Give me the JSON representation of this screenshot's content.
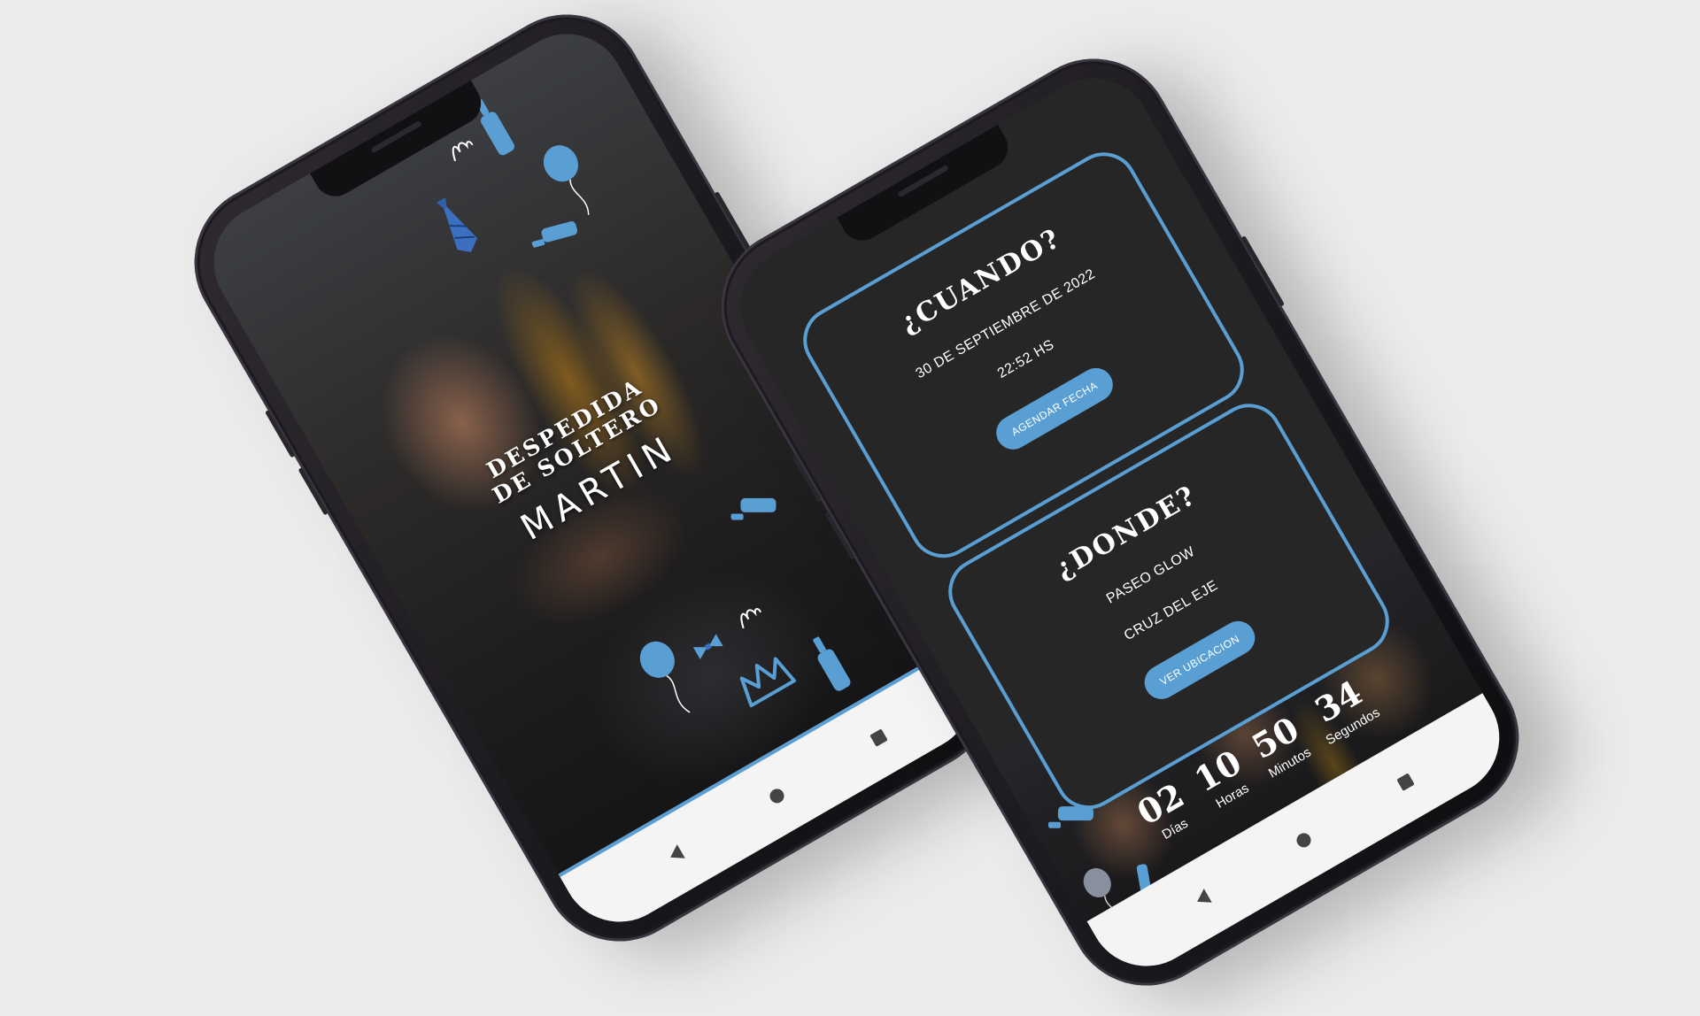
{
  "invitation": {
    "title": "DESPEDIDA DE SOLTERO",
    "name": "MARTIN"
  },
  "when": {
    "title": "¿CUANDO?",
    "date": "30 DE SEPTIEMBRE DE 2022",
    "time": "22:52 HS",
    "button": "AGENDAR FECHA"
  },
  "where": {
    "title": "¿DONDE?",
    "place": "PASEO GLOW",
    "city": "CRUZ DEL EJE",
    "button": "VER UBICACION"
  },
  "countdown": {
    "units": [
      {
        "value": "02",
        "label": "Días"
      },
      {
        "value": "10",
        "label": "Horas"
      },
      {
        "value": "50",
        "label": "Minutos"
      },
      {
        "value": "34",
        "label": "Segundos"
      }
    ]
  },
  "colors": {
    "accent": "#5a9fd4",
    "card_bg": "#262626",
    "nav_bar": "#f4f4f4"
  },
  "icons": {
    "nav": [
      "back-triangle-icon",
      "home-circle-icon",
      "recent-square-icon"
    ],
    "decorations": [
      "beer-bottle-icon",
      "balloon-icon",
      "necktie-icon",
      "crown-icon",
      "squiggle-icon"
    ]
  }
}
